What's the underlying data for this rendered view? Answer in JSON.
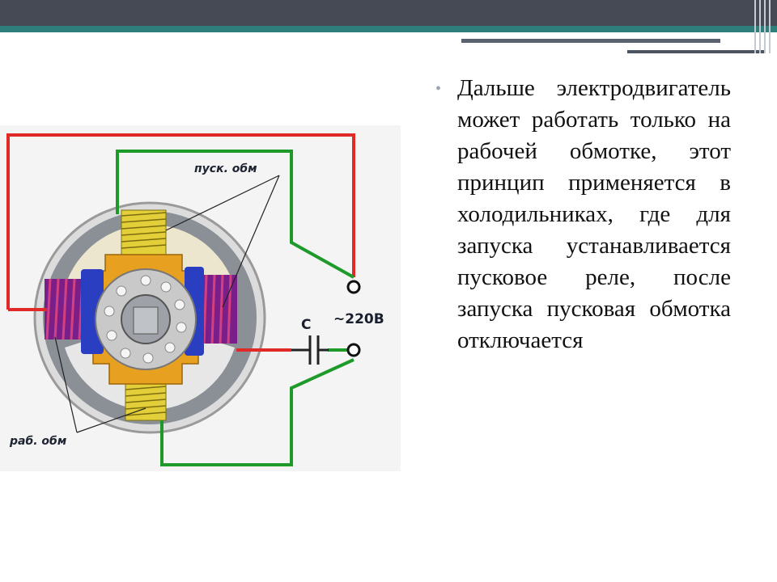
{
  "slide": {
    "bullet_text": "Дальше электродвигатель может работать только на рабочей обмотке, этот принцип применяется в холодильниках, где для запуска устанавливается пусковое реле, после запуска пусковая обмотка отключается"
  },
  "diagram": {
    "start_winding_label": "пуск. обм",
    "run_winding_label": "раб. обм",
    "capacitor_label": "С",
    "voltage_label": "~220В"
  },
  "colors": {
    "header_dark": "#454a55",
    "header_teal": "#2e7f7c",
    "wire_red": "#e02a2a",
    "wire_green": "#1e9a2a",
    "coil_yellow": "#e2cf3a",
    "coil_purple": "#7a1f8a",
    "pole_blue": "#2a3ec2",
    "core_orange": "#e8a020"
  }
}
